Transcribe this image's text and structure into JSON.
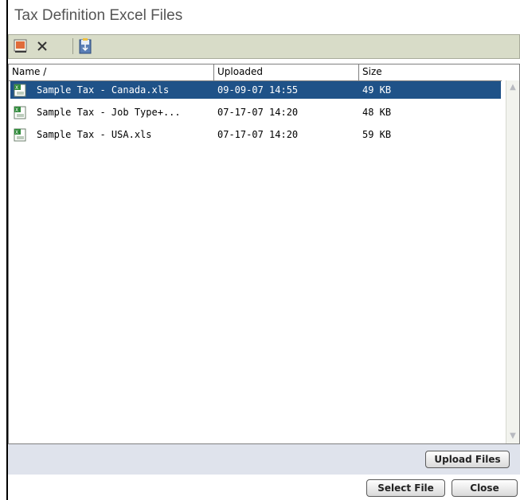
{
  "window": {
    "title": "Tax Definition Excel Files"
  },
  "toolbar": {
    "icons": [
      "open-excel-icon",
      "delete-icon",
      "download-icon"
    ]
  },
  "table": {
    "columns": [
      "Name /",
      "Uploaded",
      "Size"
    ],
    "rows": [
      {
        "name": "Sample Tax - Canada.xls",
        "uploaded": "09-09-07 14:55",
        "size": "49 KB",
        "selected": true
      },
      {
        "name": "Sample Tax - Job Type+...",
        "uploaded": "07-17-07 14:20",
        "size": "48 KB",
        "selected": false
      },
      {
        "name": "Sample Tax - USA.xls",
        "uploaded": "07-17-07 14:20",
        "size": "59 KB",
        "selected": false
      }
    ]
  },
  "buttons": {
    "upload": "Upload Files",
    "select": "Select File",
    "close": "Close"
  },
  "colors": {
    "selection": "#1f5288",
    "toolbar": "#d8dcc8",
    "footer": "#dfe3ec"
  }
}
